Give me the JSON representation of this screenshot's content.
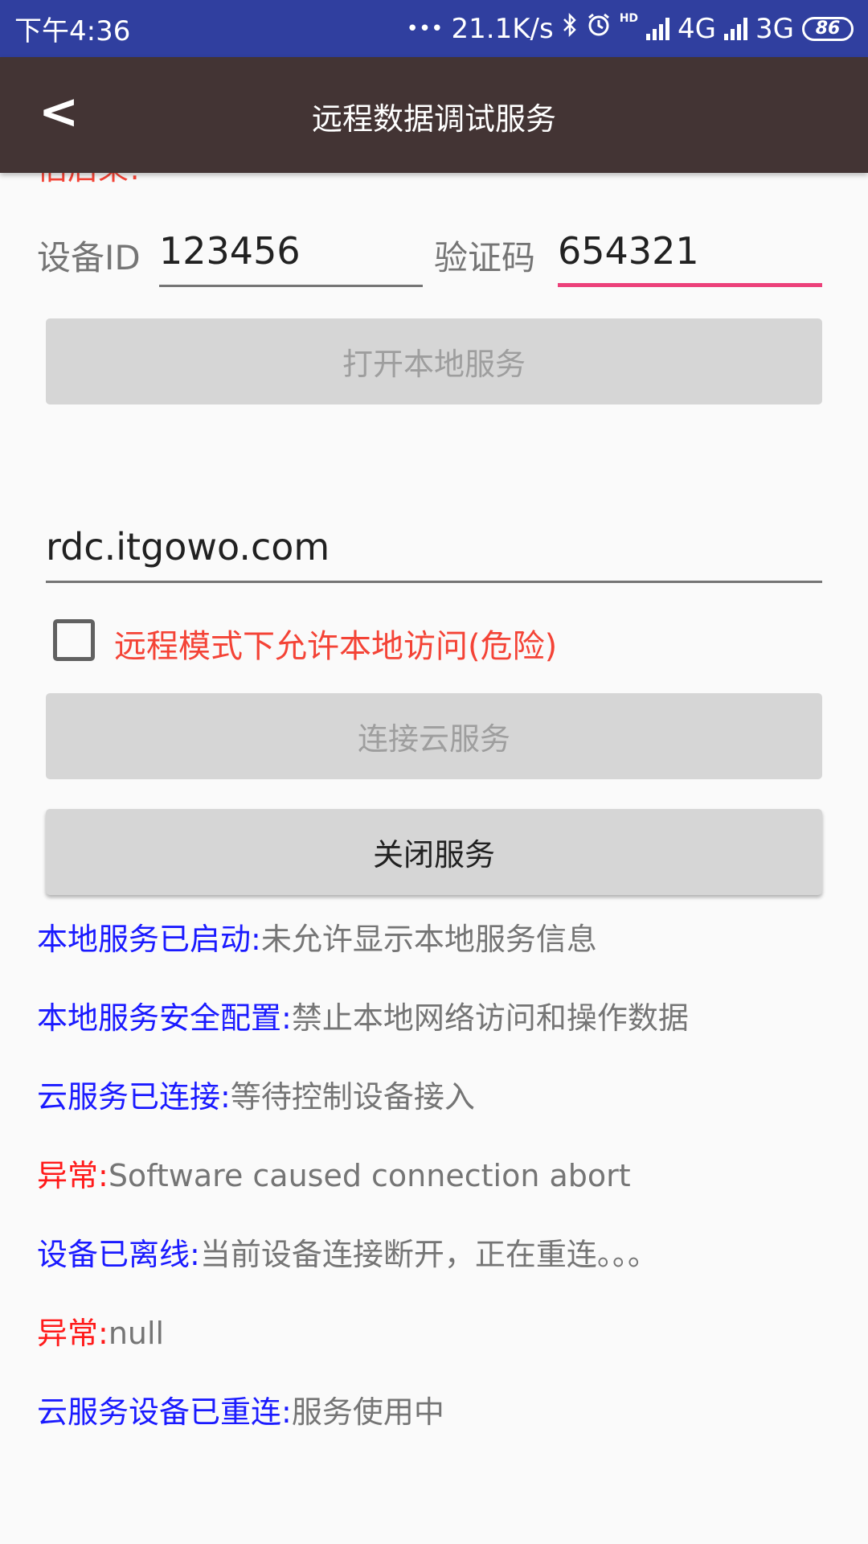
{
  "status_bar": {
    "time": "下午4:36",
    "dots": "•••",
    "net_speed": "21.1K/s",
    "bluetooth_icon": "bluetooth-icon",
    "alarm_icon": "alarm-icon",
    "hd_label": "HD",
    "net1": "4G",
    "net2": "3G",
    "battery": "86"
  },
  "toolbar": {
    "back_glyph": "<",
    "title": "远程数据调试服务"
  },
  "hint_partial": "估后果!",
  "device": {
    "id_label": "设备ID",
    "id_value": "123456",
    "code_label": "验证码",
    "code_value": "654321"
  },
  "buttons": {
    "open_local": "打开本地服务",
    "connect_cloud": "连接云服务",
    "close_service": "关闭服务"
  },
  "server_field": {
    "value": "rdc.itgowo.com"
  },
  "checkbox": {
    "label": "远程模式下允许本地访问(危险)",
    "checked": false
  },
  "colors": {
    "status_bar": "#303f9f",
    "toolbar": "#433434",
    "accent": "#ec407a",
    "danger": "#f44336",
    "log_key": "#1a1aff",
    "log_error": "#ff1a1a"
  },
  "logs": [
    {
      "key": "本地服务已启动:",
      "msg": "未允许显示本地服务信息",
      "type": "info"
    },
    {
      "key": "本地服务安全配置:",
      "msg": "禁止本地网络访问和操作数据",
      "type": "info"
    },
    {
      "key": "云服务已连接:",
      "msg": "等待控制设备接入",
      "type": "info"
    },
    {
      "key": "异常:",
      "msg": "Software caused connection abort",
      "type": "error"
    },
    {
      "key": "设备已离线:",
      "msg": "当前设备连接断开，正在重连。。。",
      "type": "info"
    },
    {
      "key": "异常:",
      "msg": "null",
      "type": "error"
    },
    {
      "key": "云服务设备已重连:",
      "msg": "服务使用中",
      "type": "info"
    }
  ]
}
